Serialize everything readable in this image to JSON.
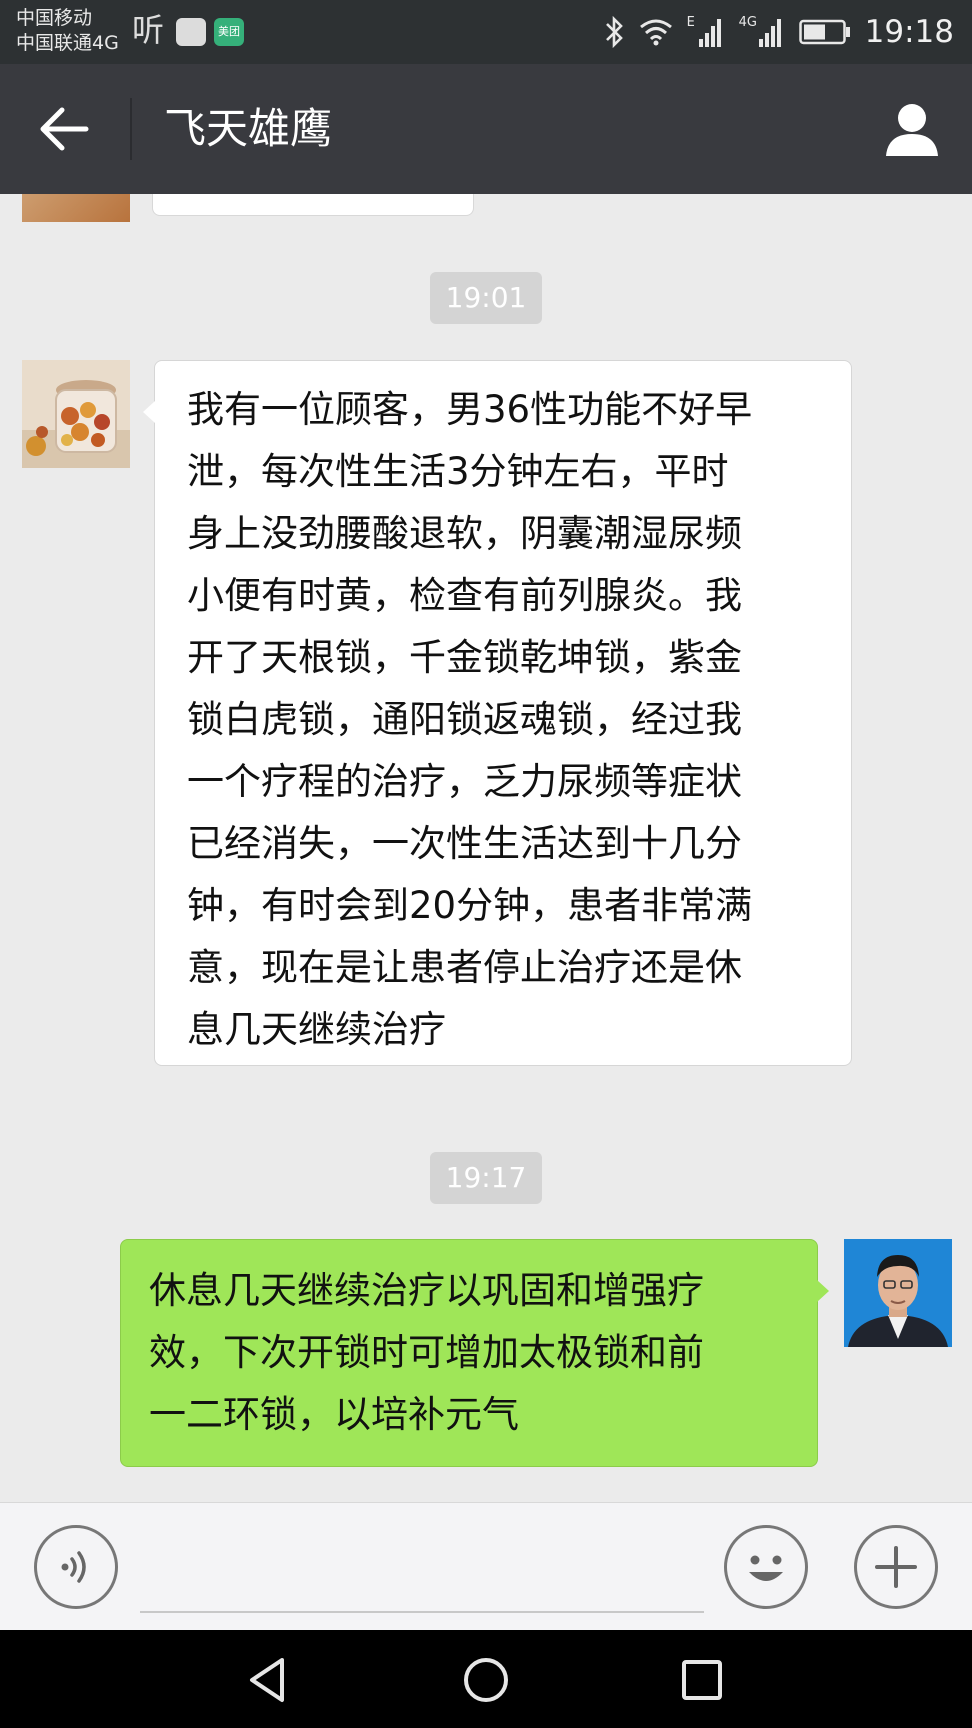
{
  "status_bar": {
    "carrier_1": "中国移动",
    "carrier_2": "中国联通4G",
    "app_ting": "听",
    "app_meituan": "美团",
    "signal_1_label": "E",
    "signal_2_label": "4G",
    "time": "19:18",
    "icons": [
      "bluetooth-icon",
      "wifi-icon",
      "signal-icon",
      "battery-icon"
    ]
  },
  "title_bar": {
    "title": "飞天雄鹰",
    "back_icon": "arrow-left-icon",
    "profile_icon": "person-icon"
  },
  "messages": [
    {
      "type": "time",
      "text": "19:01"
    },
    {
      "type": "incoming",
      "lines": [
        "我有一位顾客，男36性功能不好早",
        "泄，每次性生活3分钟左右，平时",
        "身上没劲腰酸退软，阴囊潮湿尿频",
        "小便有时黄，检查有前列腺炎。我",
        "开了天根锁，千金锁乾坤锁，紫金",
        "锁白虎锁，通阳锁返魂锁，经过我",
        "一个疗程的治疗，乏力尿频等症状",
        "已经消失，一次性生活达到十几分",
        "钟，有时会到20分钟，患者非常满",
        "意，现在是让患者停止治疗还是休",
        "息几天继续治疗"
      ]
    },
    {
      "type": "time",
      "text": "19:17"
    },
    {
      "type": "outgoing",
      "lines": [
        "休息几天继续治疗以巩固和增强疗",
        "效，下次开锁时可增加太极锁和前",
        "一二环锁，以培补元气"
      ]
    }
  ],
  "input_bar": {
    "input_value": "",
    "voice_icon": "voice-icon",
    "emoji_icon": "emoji-icon",
    "plus_icon": "plus-icon"
  },
  "nav_bar": {
    "icons": [
      "back-triangle-icon",
      "home-circle-icon",
      "recents-square-icon"
    ]
  },
  "colors": {
    "header": "#393a3f",
    "chat_bg": "#ebebeb",
    "incoming_bubble": "#ffffff",
    "outgoing_bubble": "#9fe658",
    "time_chip": "#d4d4d4"
  }
}
